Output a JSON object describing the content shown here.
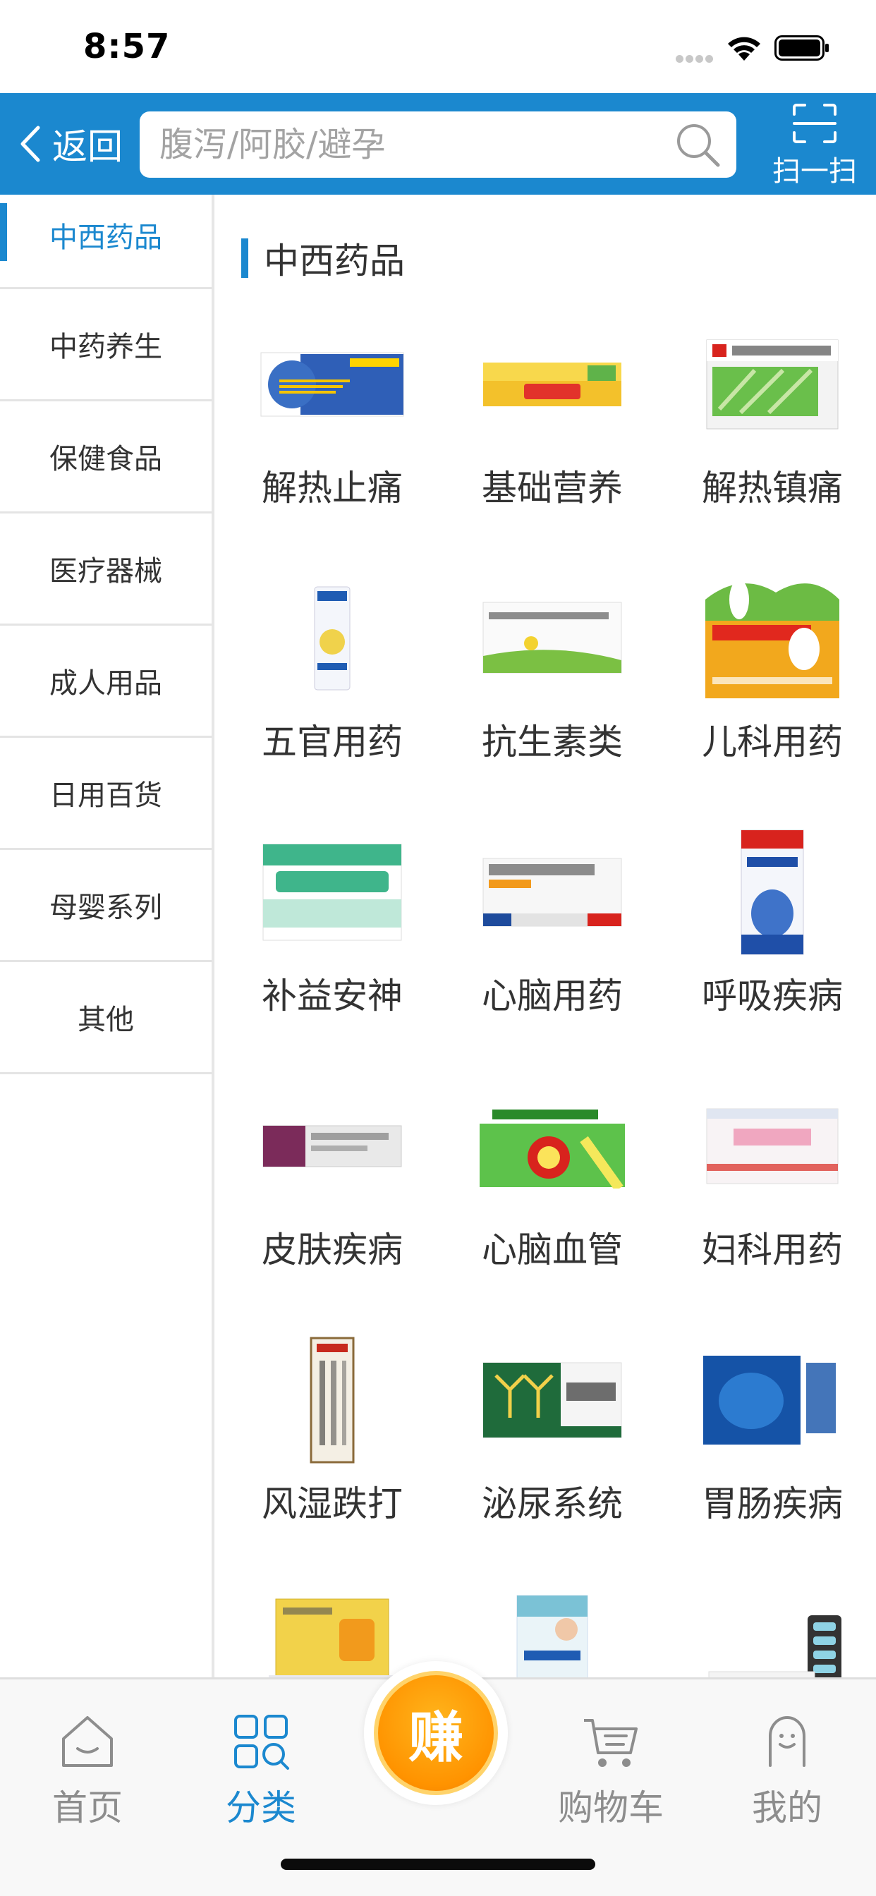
{
  "status_bar": {
    "time": "8:57"
  },
  "nav": {
    "back_label": "返回",
    "search_placeholder": "腹泻/阿胶/避孕",
    "scan_label": "扫一扫"
  },
  "sidebar": {
    "items": [
      {
        "label": "中西药品",
        "active": true
      },
      {
        "label": "中药养生"
      },
      {
        "label": "保健食品"
      },
      {
        "label": "医疗器械"
      },
      {
        "label": "成人用品"
      },
      {
        "label": "日用百货"
      },
      {
        "label": "母婴系列"
      },
      {
        "label": "其他"
      }
    ]
  },
  "section": {
    "title": "中西药品"
  },
  "categories": [
    {
      "label": "解热止痛",
      "icon": "blue-white-medicine-box"
    },
    {
      "label": "基础营养",
      "icon": "yellow-red-vitamin-box"
    },
    {
      "label": "解热镇痛",
      "icon": "green-cold-granules-box"
    },
    {
      "label": "五官用药",
      "icon": "white-blue-bottle"
    },
    {
      "label": "抗生素类",
      "icon": "white-green-antibiotic-box"
    },
    {
      "label": "儿科用药",
      "icon": "rabbit-kids-medicine-box"
    },
    {
      "label": "补益安神",
      "icon": "green-white-pill-box"
    },
    {
      "label": "心脑用药",
      "icon": "white-orange-tablet-box"
    },
    {
      "label": "呼吸疾病",
      "icon": "blue-syrup-box"
    },
    {
      "label": "皮肤疾病",
      "icon": "purple-ointment-box"
    },
    {
      "label": "心脑血管",
      "icon": "green-tea-box"
    },
    {
      "label": "妇科用药",
      "icon": "pink-white-box"
    },
    {
      "label": "风湿跌打",
      "icon": "tall-brown-bottle-box"
    },
    {
      "label": "泌尿系统",
      "icon": "green-sanjin-tablet-box"
    },
    {
      "label": "胃肠疾病",
      "icon": "blue-granule-box"
    },
    {
      "label": "",
      "icon": "yellow-stomach-box"
    },
    {
      "label": "",
      "icon": "white-blue-box"
    },
    {
      "label": "",
      "icon": "blister-pack-box"
    }
  ],
  "tab_bar": {
    "home_label": "首页",
    "category_label": "分类",
    "earn_label": "赚",
    "cart_label": "购物车",
    "mine_label": "我的"
  },
  "colors": {
    "primary": "#1b88cf",
    "earn": "#ff9800",
    "tab_inactive": "#8d8d8d"
  }
}
